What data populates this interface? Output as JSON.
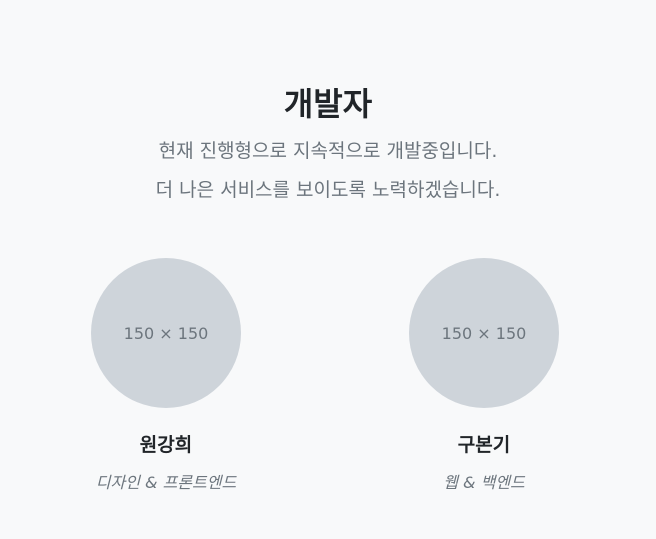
{
  "header": {
    "title": "개발자",
    "subtitle_line1": "현재 진행형으로 지속적으로 개발중입니다.",
    "subtitle_line2": "더 나은 서비스를 보이도록 노력하겠습니다."
  },
  "team": {
    "members": [
      {
        "avatar_placeholder": "150 × 150",
        "name": "원강희",
        "role": "디자인 & 프론트엔드"
      },
      {
        "avatar_placeholder": "150 × 150",
        "name": "구본기",
        "role": "웹 & 백엔드"
      }
    ]
  },
  "colors": {
    "background": "#f8f9fa",
    "heading": "#212529",
    "muted_text": "#6c757d",
    "avatar_placeholder_bg": "#ced4da"
  }
}
